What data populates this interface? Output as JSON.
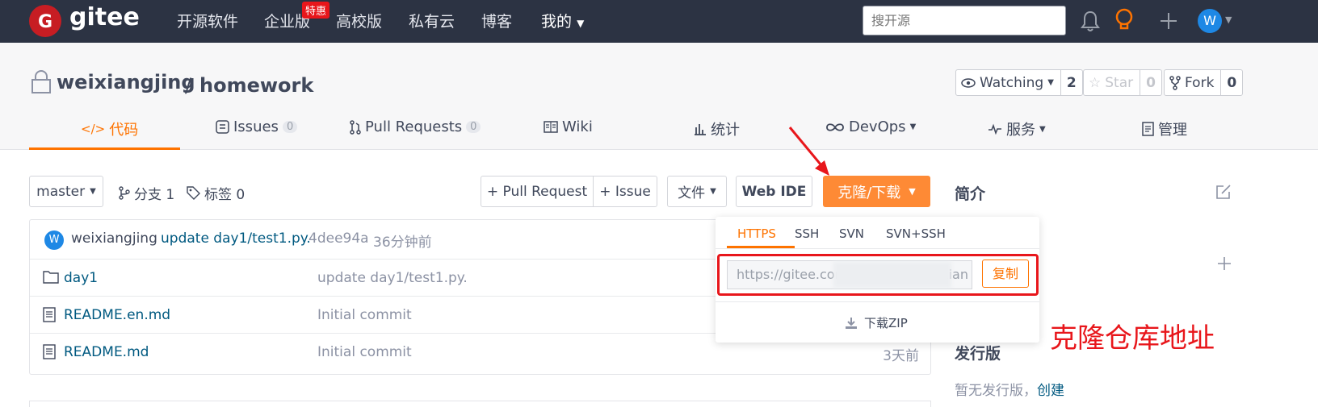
{
  "topnav": {
    "logo_text": "gitee",
    "items": [
      "开源软件",
      "企业版",
      "高校版",
      "私有云",
      "博客",
      "我的"
    ],
    "hot_badge": "特惠",
    "search_placeholder": "搜开源",
    "avatar_letter": "W"
  },
  "repo": {
    "owner": "weixiangjing",
    "separator": "/",
    "name": "homework",
    "watch": {
      "label": "Watching",
      "count": "2"
    },
    "star": {
      "label": "Star",
      "count": "0"
    },
    "fork": {
      "label": "Fork",
      "count": "0"
    }
  },
  "tabs": [
    {
      "label": "代码",
      "active": true
    },
    {
      "label": "Issues",
      "count": "0"
    },
    {
      "label": "Pull Requests",
      "count": "0"
    },
    {
      "label": "Wiki"
    },
    {
      "label": "统计"
    },
    {
      "label": "DevOps"
    },
    {
      "label": "服务"
    },
    {
      "label": "管理"
    }
  ],
  "toolbar": {
    "branch": "master",
    "branches": "分支 1",
    "tags": "标签 0",
    "pull_request": "+ Pull Request",
    "issue": "+ Issue",
    "files": "文件",
    "web_ide": "Web IDE",
    "clone": "克隆/下载"
  },
  "commit": {
    "avatar_letter": "W",
    "author": "weixiangjing",
    "message": "update day1/test1.py.",
    "hash": "4dee94a",
    "time": "36分钟前"
  },
  "files": [
    {
      "name": "day1",
      "type": "folder",
      "message": "update day1/test1.py.",
      "time": ""
    },
    {
      "name": "README.en.md",
      "type": "file",
      "message": "Initial commit",
      "time": ""
    },
    {
      "name": "README.md",
      "type": "file",
      "message": "Initial commit",
      "time": "3天前"
    }
  ],
  "clone_dropdown": {
    "tabs": [
      "HTTPS",
      "SSH",
      "SVN",
      "SVN+SSH"
    ],
    "active_tab": "HTTPS",
    "url_visible": "https://gitee.com",
    "url_tail": "xian",
    "copy": "复制",
    "download_zip": "下载ZIP"
  },
  "sidebar": {
    "intro_title": "简介",
    "releases_title": "发行版",
    "no_release": "暂无发行版，",
    "create": "创建"
  },
  "annotation": "克隆仓库地址",
  "colors": {
    "accent": "#fe7300",
    "nav_bg": "#2c3343",
    "annotation": "#e8161b"
  }
}
